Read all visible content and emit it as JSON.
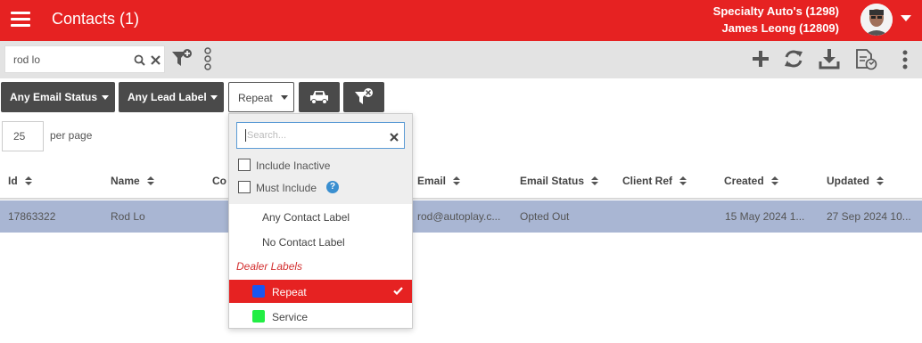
{
  "header": {
    "title": "Contacts (1)",
    "dealer": "Specialty Auto's (1298)",
    "user": "James Leong (12809)"
  },
  "toolbar": {
    "search_value": "rod lo"
  },
  "filters": {
    "email_status": "Any Email Status",
    "lead_label": "Any Lead Label",
    "contact_label": "Repeat"
  },
  "paging": {
    "per_page_value": "25",
    "per_page_label": "per page"
  },
  "table": {
    "columns": [
      "Id",
      "Name",
      "Co",
      "Email",
      "Email Status",
      "Client Ref",
      "Created",
      "Updated"
    ],
    "rows": [
      {
        "id": "17863322",
        "name": "Rod Lo",
        "email": "rod@autoplay.c...",
        "email_status": "Opted Out",
        "client_ref": "",
        "created": "15 May 2024 1...",
        "updated": "27 Sep 2024 10..."
      }
    ]
  },
  "dropdown": {
    "search_placeholder": "Search...",
    "include_inactive": "Include Inactive",
    "must_include": "Must Include",
    "options": [
      "Any Contact Label",
      "No Contact Label"
    ],
    "group_label": "Dealer Labels",
    "labels": [
      {
        "name": "Repeat",
        "color": "#1a56f0",
        "selected": true
      },
      {
        "name": "Service",
        "color": "#22ee44",
        "selected": false
      }
    ]
  },
  "colors": {
    "brand_red": "#e62222",
    "dark_button": "#4a4a4a",
    "row_highlight": "#a9b6d3"
  }
}
